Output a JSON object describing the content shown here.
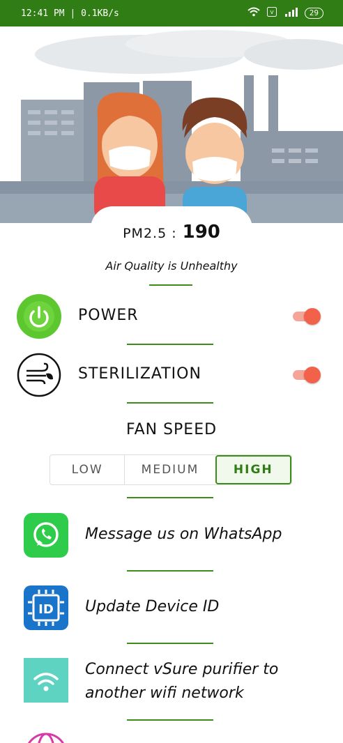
{
  "status_bar": {
    "time": "12:41 PM | 0.1KB/s",
    "battery": "29",
    "icons": [
      "wifi-icon",
      "volte-icon",
      "signal-icon"
    ]
  },
  "air": {
    "pm_label": "PM2.5 :",
    "pm_value": "190",
    "quality": "Air Quality is Unhealthy"
  },
  "controls": {
    "power": {
      "label": "POWER",
      "on": true
    },
    "sterilization": {
      "label": "STERILIZATION",
      "on": true
    }
  },
  "fan": {
    "title": "FAN SPEED",
    "options": [
      "LOW",
      "MEDIUM",
      "HIGH"
    ],
    "selected": "HIGH"
  },
  "menu": {
    "whatsapp": "Message us on WhatsApp",
    "device_id": "Update Device ID",
    "wifi_line1": "Connect vSure purifier to",
    "wifi_line2": "another wifi network"
  },
  "colors": {
    "status_bar": "#2f7d14",
    "accent_green": "#3c8c1a",
    "toggle_on": "#f2614a",
    "power_icon": "#5cc72e",
    "whatsapp": "#2ecc4a",
    "device_id": "#1a74c9",
    "wifi": "#5ed3c1"
  }
}
